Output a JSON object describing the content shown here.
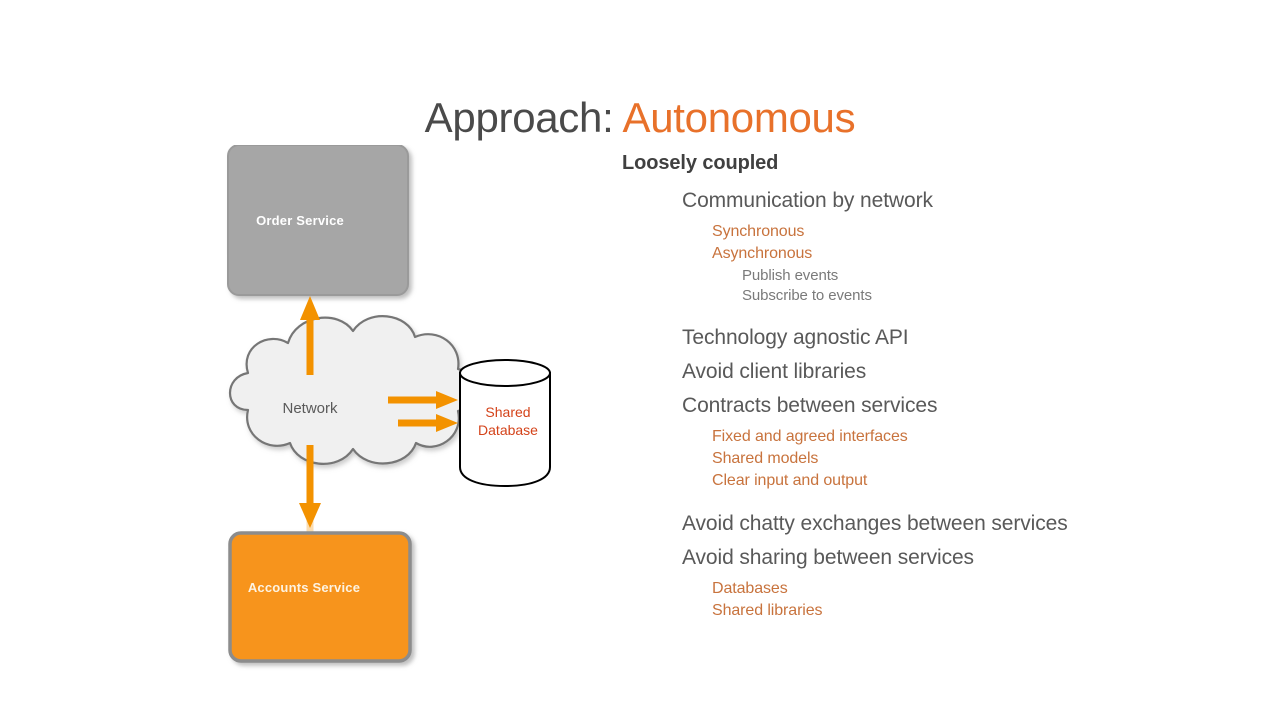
{
  "title": {
    "main": "Approach: ",
    "accent": "Autonomous"
  },
  "colors": {
    "title_gray": "#4a4a4a",
    "title_orange": "#e8712a",
    "arrow_orange": "#f39200",
    "box_gray": "#a6a6a6",
    "box_orange": "#f7941e",
    "cloud_fill": "#f0f0f0",
    "cloud_stroke": "#767676",
    "db_text": "#d4431a",
    "bullet_l1": "#404040",
    "bullet_l2": "#595959",
    "bullet_l3": "#c8733d",
    "bullet_l4": "#7a7a7a"
  },
  "diagram": {
    "order_service": "Order Service",
    "network": "Network",
    "shared_database": "Shared\nDatabase",
    "accounts_service": "Accounts Service"
  },
  "bullets": [
    {
      "level": 1,
      "text": "Loosely coupled"
    },
    {
      "level": 2,
      "text": "Communication by network"
    },
    {
      "level": 3,
      "text": "Synchronous"
    },
    {
      "level": 3,
      "text": "Asynchronous"
    },
    {
      "level": 4,
      "text": "Publish events"
    },
    {
      "level": 4,
      "text": "Subscribe to events"
    },
    {
      "level": 2,
      "text": "Technology agnostic API",
      "gap": true
    },
    {
      "level": 2,
      "text": "Avoid client libraries"
    },
    {
      "level": 2,
      "text": "Contracts between services"
    },
    {
      "level": 3,
      "text": "Fixed and agreed interfaces"
    },
    {
      "level": 3,
      "text": "Shared models"
    },
    {
      "level": 3,
      "text": "Clear input and output"
    },
    {
      "level": 2,
      "text": "Avoid chatty exchanges between services",
      "gap": true
    },
    {
      "level": 2,
      "text": "Avoid sharing between services"
    },
    {
      "level": 3,
      "text": "Databases"
    },
    {
      "level": 3,
      "text": "Shared libraries"
    }
  ]
}
